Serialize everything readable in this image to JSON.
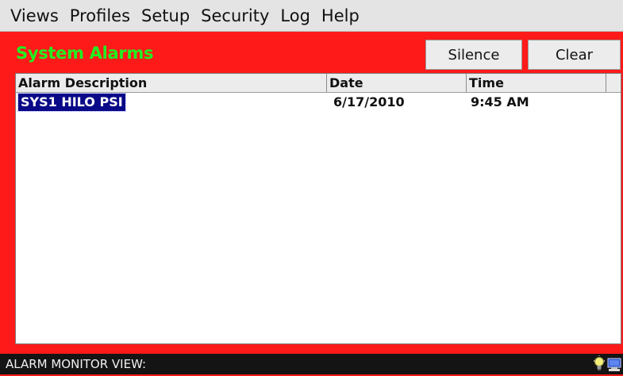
{
  "menu": {
    "items": [
      "Views",
      "Profiles",
      "Setup",
      "Security",
      "Log",
      "Help"
    ]
  },
  "panel": {
    "title": "System Alarms",
    "silence_label": "Silence",
    "clear_label": "Clear"
  },
  "table": {
    "columns": [
      "Alarm Description",
      "Date",
      "Time"
    ],
    "rows": [
      {
        "description": "SYS1 HILO PSI",
        "date": "6/17/2010",
        "time": "9:45 AM",
        "selected": true
      }
    ]
  },
  "status": {
    "text": "ALARM MONITOR VIEW:",
    "tray_icons": [
      "lightbulb-icon",
      "network-computer-icon"
    ]
  },
  "colors": {
    "panel_background": "#ff1a1a",
    "title_text": "#22ee22",
    "selection": "#0a0a88",
    "statusbar": "#141414"
  }
}
